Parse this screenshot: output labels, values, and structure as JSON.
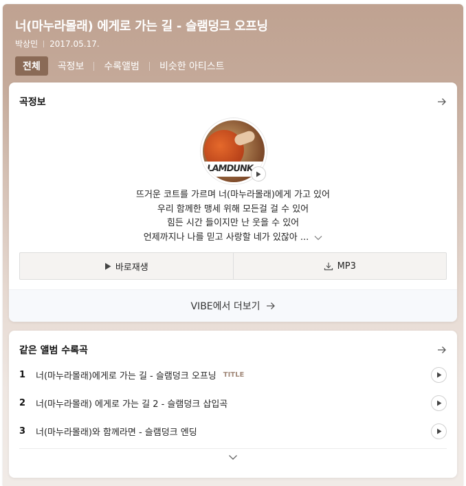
{
  "header": {
    "title": "너(마누라몰래) 에게로 가는 길 - 슬램덩크 오프닝",
    "artist": "박상민",
    "date": "2017.05.17."
  },
  "tabs": [
    {
      "label": "전체",
      "active": true
    },
    {
      "label": "곡정보",
      "active": false
    },
    {
      "label": "수록앨범",
      "active": false
    },
    {
      "label": "비슷한 아티스트",
      "active": false
    }
  ],
  "song_info": {
    "heading": "곡정보",
    "album_art_text": "LAMDUNK",
    "lyrics": [
      "뜨거운 코트를 가르며 너(마누라몰래)에게 가고 있어",
      "우리 함께한 맹세 위해 모든걸 걸 수 있어",
      "힘든 시간 들이지만 난 웃을 수 있어",
      "언제까지나 나를 믿고 사랑할 네가 있잖아 ..."
    ],
    "play_label": "바로재생",
    "mp3_label": "MP3",
    "more_label": "VIBE에서 더보기"
  },
  "same_album": {
    "heading": "같은 앨범 수록곡",
    "tracks": [
      {
        "num": "1",
        "title": "너(마누라몰래)에게로 가는 길 - 슬램덩크 오프닝",
        "badge": "TITLE"
      },
      {
        "num": "2",
        "title": "너(마누라몰래) 에게로 가는 길 2 - 슬램덩크 삽입곡",
        "badge": ""
      },
      {
        "num": "3",
        "title": "너(마누라몰래)와 함께라면 - 슬램덩크 엔딩",
        "badge": ""
      }
    ]
  },
  "colors": {
    "header_bg": "#bfa291",
    "active_tab": "#8a6a56",
    "title_badge": "#a38b7c"
  },
  "icons": [
    "arrow-right-icon",
    "play-icon",
    "download-icon",
    "chevron-down-icon"
  ]
}
